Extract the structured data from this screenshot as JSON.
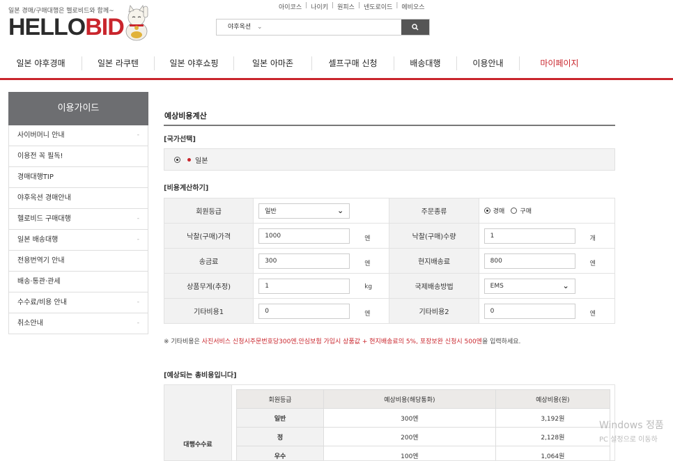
{
  "header": {
    "tagline": "일본 경매/구매대행은 헬로비드와 함께~",
    "logo_hello": "HELLO",
    "logo_bid": "BID",
    "top_links": [
      "아이코스",
      "나이키",
      "원피스",
      "넨도로이드",
      "에비오스"
    ],
    "search_select": "야후옥션",
    "nav": [
      "일본 야후경매",
      "일본 라쿠텐",
      "일본 야후쇼핑",
      "일본 아마존",
      "셀프구매 신청",
      "배송대행",
      "이용안내",
      "마이페이지"
    ]
  },
  "sidebar": {
    "title": "이용가이드",
    "items": [
      "사이버머니 안내",
      "이용전 꼭 필독!",
      "경매대행TIP",
      "야후옥션 경매안내",
      "헬로비드 구매대행",
      "일본 배송대행",
      "전용번역기 안내",
      "배송·통관·관세",
      "수수료/비용 안내",
      "취소안내"
    ]
  },
  "main": {
    "title": "예상비용계산",
    "country_label": "[국가선택]",
    "country_option": "일본",
    "calc_label": "[비용계산하기]",
    "fields": {
      "member_grade_label": "회원등급",
      "member_grade_value": "일반",
      "order_type_label": "주문종류",
      "order_type_options": [
        "경매",
        "구매"
      ],
      "price_label": "낙찰(구매)가격",
      "price_value": "1000",
      "price_unit": "엔",
      "qty_label": "낙찰(구매)수량",
      "qty_value": "1",
      "qty_unit": "개",
      "remit_label": "송금료",
      "remit_value": "300",
      "remit_unit": "엔",
      "local_ship_label": "현지배송료",
      "local_ship_value": "800",
      "local_ship_unit": "엔",
      "weight_label": "상품무게(추정)",
      "weight_value": "1",
      "weight_unit": "kg",
      "intl_method_label": "국제배송방법",
      "intl_method_value": "EMS",
      "etc1_label": "기타비용1",
      "etc1_value": "0",
      "etc1_unit": "엔",
      "etc2_label": "기타비용2",
      "etc2_value": "0",
      "etc2_unit": "엔"
    },
    "note_prefix": "※ 기타비용은 ",
    "note_highlight": "사진서비스 신청시주문번호당300엔,안심보험 가입시 상품값 + 현지배송료의 5%, 포장보완 신청시 500엔",
    "note_suffix": "을 입력하세요.",
    "total_label": "[예상되는 총비용입니다]",
    "total_row_label": "대행수수료",
    "fee_table": {
      "headers": [
        "회원등급",
        "예상비용(해당통화)",
        "예상비용(원)"
      ],
      "rows": [
        [
          "일반",
          "300엔",
          "3,192원"
        ],
        [
          "정",
          "200엔",
          "2,128원"
        ],
        [
          "우수",
          "100엔",
          "1,064원"
        ]
      ]
    }
  },
  "watermark": {
    "line1": "Windows 정품",
    "line2": "PC 설정으로 이동하"
  }
}
